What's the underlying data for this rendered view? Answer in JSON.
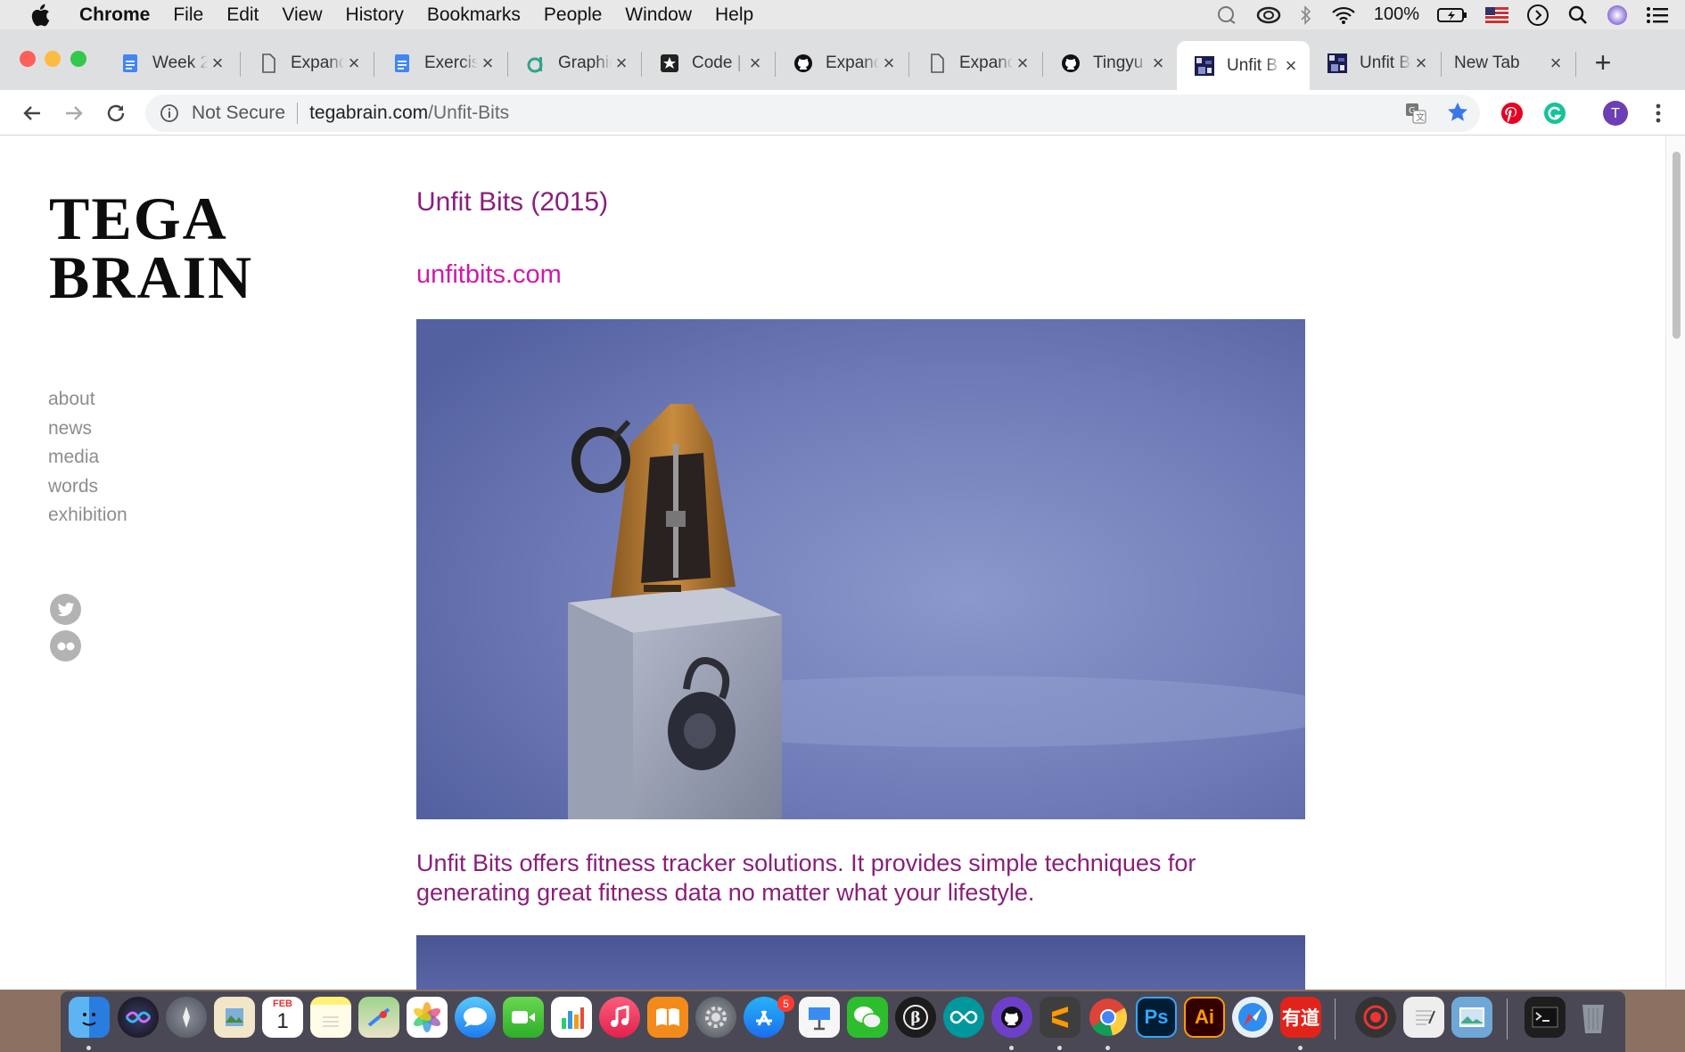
{
  "menubar": {
    "app_name": "Chrome",
    "items": [
      "File",
      "Edit",
      "View",
      "History",
      "Bookmarks",
      "People",
      "Window",
      "Help"
    ],
    "battery": "100%"
  },
  "tabs": [
    {
      "title": "Week 2",
      "icon": "google-docs-icon"
    },
    {
      "title": "Expand",
      "icon": "document-icon"
    },
    {
      "title": "Exercise",
      "icon": "google-docs-icon"
    },
    {
      "title": "Graphic",
      "icon": "graphic-icon"
    },
    {
      "title": "Code |",
      "icon": "star-badge-icon"
    },
    {
      "title": "Expand",
      "icon": "github-icon"
    },
    {
      "title": "Expand",
      "icon": "document-icon"
    },
    {
      "title": "Tingyu",
      "icon": "github-icon"
    },
    {
      "title": "Unfit B",
      "icon": "unfit-favicon",
      "active": true
    },
    {
      "title": "Unfit B",
      "icon": "unfit-favicon"
    },
    {
      "title": "New Tab",
      "icon": ""
    }
  ],
  "toolbar": {
    "security_label": "Not Secure",
    "url_host": "tegabrain.com",
    "url_path": "/Unfit-Bits",
    "profile_initial": "T"
  },
  "site": {
    "logo_line1": "TEGA",
    "logo_line2": "BRAIN",
    "nav": [
      "about",
      "news",
      "media",
      "words",
      "exhibition"
    ],
    "social": [
      "twitter-icon",
      "flickr-icon"
    ]
  },
  "project": {
    "title": "Unfit Bits (2015)",
    "link_text": "unfitbits.com",
    "description": "Unfit Bits offers fitness tracker solutions. It provides simple techniques for generating great fitness data no matter what your lifestyle."
  },
  "dock": {
    "calendar_month": "FEB",
    "calendar_day": "1",
    "appstore_badge": "5",
    "youdao_label": "有道",
    "ps_label": "Ps",
    "ai_label": "Ai"
  },
  "colors": {
    "title_purple": "#8a1f7b",
    "link_magenta": "#cf1aa8",
    "nav_gray": "#8d8d8d"
  }
}
